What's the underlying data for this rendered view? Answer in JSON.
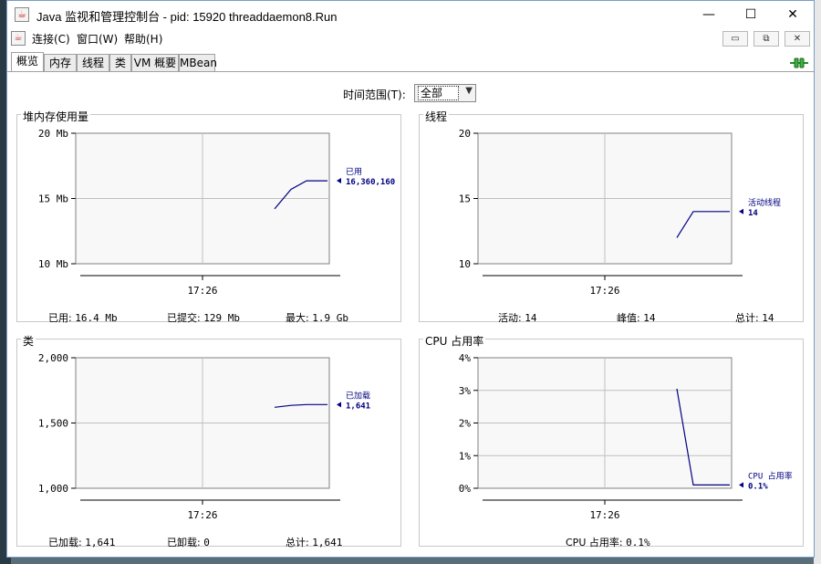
{
  "window": {
    "title": "Java 监视和管理控制台 - pid: 15920 threaddaemon8.Run",
    "minimize": "—",
    "maximize": "☐",
    "close": "✕"
  },
  "menu": {
    "items": [
      "连接(C)",
      "窗口(W)",
      "帮助(H)"
    ],
    "mdi_minimize": "▭",
    "mdi_restore": "⧉",
    "mdi_close": "✕"
  },
  "tabs": [
    {
      "label": "概览",
      "active": true
    },
    {
      "label": "内存",
      "active": false
    },
    {
      "label": "线程",
      "active": false
    },
    {
      "label": "类",
      "active": false
    },
    {
      "label": "VM 概要",
      "active": false
    },
    {
      "label": "MBean",
      "active": false
    }
  ],
  "time_range": {
    "label": "时间范围(T):",
    "value": "全部"
  },
  "colors": {
    "series": "#000080",
    "grid": "#c0c0c0",
    "plot_bg": "#f8f8f8"
  },
  "chart_data": [
    {
      "type": "line",
      "title": "堆内存使用量",
      "yticks": [
        "20 Mb",
        "15 Mb",
        "10 Mb"
      ],
      "ylim": [
        10,
        20
      ],
      "xtick": "17:26",
      "series": [
        {
          "name": "已用",
          "value_label": "16,360,160",
          "y": [
            14.2,
            15.7,
            16.36,
            16.36
          ]
        }
      ],
      "stats": [
        {
          "label": "已用:",
          "value": "16.4 Mb"
        },
        {
          "label": "已提交:",
          "value": "129 Mb"
        },
        {
          "label": "最大:",
          "value": "1.9 Gb"
        }
      ]
    },
    {
      "type": "line",
      "title": "线程",
      "yticks": [
        "20",
        "15",
        "10"
      ],
      "ylim": [
        10,
        20
      ],
      "xtick": "17:26",
      "series": [
        {
          "name": "活动线程",
          "value_label": "14",
          "y": [
            12,
            14,
            14,
            14
          ]
        }
      ],
      "stats": [
        {
          "label": "活动:",
          "value": "14"
        },
        {
          "label": "峰值:",
          "value": "14"
        },
        {
          "label": "总计:",
          "value": "14"
        }
      ]
    },
    {
      "type": "line",
      "title": "类",
      "yticks": [
        "2,000",
        "1,500",
        "1,000"
      ],
      "ylim": [
        1000,
        2000
      ],
      "xtick": "17:26",
      "series": [
        {
          "name": "已加载",
          "value_label": "1,641",
          "y": [
            1620,
            1635,
            1641,
            1641
          ]
        }
      ],
      "stats": [
        {
          "label": "已加载:",
          "value": "1,641"
        },
        {
          "label": "已卸载:",
          "value": "0"
        },
        {
          "label": "总计:",
          "value": "1,641"
        }
      ]
    },
    {
      "type": "line",
      "title": "CPU 占用率",
      "yticks": [
        "4%",
        "3%",
        "2%",
        "1%",
        "0%"
      ],
      "ylim": [
        0,
        4
      ],
      "xtick": "17:26",
      "series": [
        {
          "name": "CPU 占用率",
          "value_label": "0.1%",
          "y": [
            3.05,
            0.1,
            0.1,
            0.1
          ]
        }
      ],
      "stats": [
        {
          "label": "CPU 占用率:",
          "value": "0.1%"
        }
      ]
    }
  ]
}
